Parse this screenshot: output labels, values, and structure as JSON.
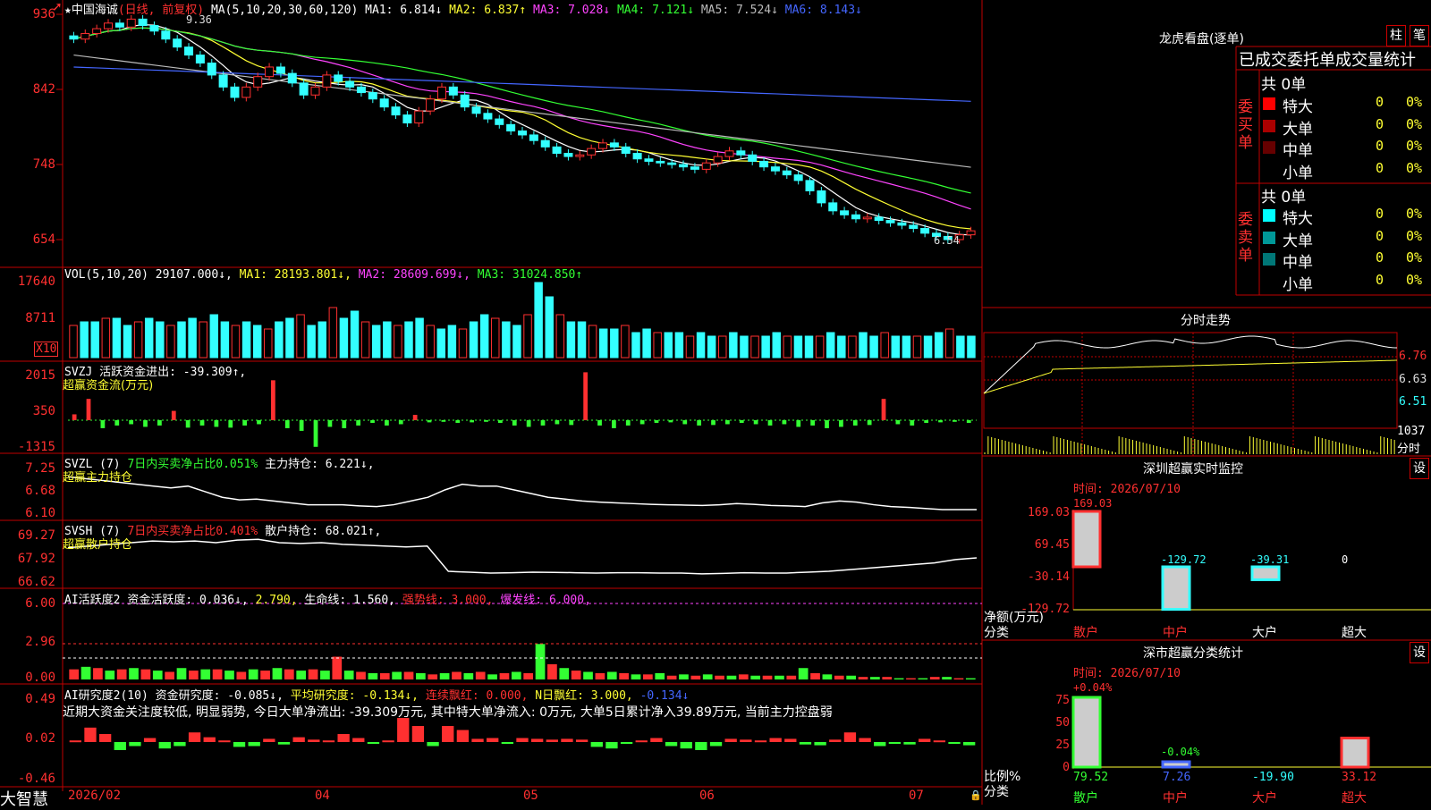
{
  "header": {
    "stock_name": "★中国海诚",
    "stock_mode": "(日线, 前复权)",
    "ma_title": "MA(5,10,20,30,60,120)",
    "ma1": "MA1: 6.814↓",
    "ma2": "MA2: 6.837↑",
    "ma3": "MA3: 7.028↓",
    "ma4": "MA4: 7.121↓",
    "ma5": "MA5: 7.524↓",
    "ma6": "MA6: 8.143↓",
    "high_label": "9.36",
    "low_label": "6.54"
  },
  "price_axis": [
    "936",
    "842",
    "748",
    "654"
  ],
  "vol_panel": {
    "title": "VOL(5,10,20)",
    "value": "29107.000↓,",
    "ma1": "MA1: 28193.801↓,",
    "ma2": "MA2: 28609.699↓,",
    "ma3": "MA3: 31024.850↑",
    "axis": [
      "17640",
      "8711",
      "X10"
    ]
  },
  "svzj_panel": {
    "title": "SVZJ  活跃资金进出: -39.309↑,",
    "subtitle": "超赢资金流(万元)",
    "axis": [
      "2015",
      "350",
      "-1315"
    ]
  },
  "svzl_panel": {
    "title": "SVZL (7)",
    "ratio": "7日内买卖净占比0.051%",
    "hold": "主力持仓: 6.221↓,",
    "subtitle": "超赢主力持仓",
    "axis": [
      "7.25",
      "6.68",
      "6.10"
    ]
  },
  "svsh_panel": {
    "title": "SVSH (7)",
    "ratio": "7日内买卖净占比0.401%",
    "hold": "散户持仓: 68.021↑,",
    "subtitle": "超赢散户持仓",
    "axis": [
      "69.27",
      "67.92",
      "66.62"
    ]
  },
  "ai_active_panel": {
    "title": "AI活跃度2",
    "activity": "资金活跃度: 0.036↓,",
    "v2": "2.790,",
    "life": "生命线: 1.560,",
    "strong": "强势线: 3.000,",
    "burst": "爆发线: 6.000,",
    "axis": [
      "6.00",
      "2.96",
      "0.00"
    ]
  },
  "ai_research_panel": {
    "title": "AI研究度2(10)",
    "research": "资金研究度: -0.085↓,",
    "avg": "平均研究度: -0.134↓,",
    "cont": "连续飘红: 0.000,",
    "n": "N日飘红: 3.000,",
    "last": "-0.134↓",
    "comment": "近期大资金关注度较低, 明显弱势, 今日大单净流出: -39.309万元, 其中特大单净流入: 0万元, 大单5日累计净入39.89万元, 当前主力控盘弱",
    "axis": [
      "0.49",
      "0.02",
      "-0.46"
    ]
  },
  "bottom_bar": {
    "brand": "大智慧",
    "dates": [
      "2026/02",
      "04",
      "05",
      "06",
      "07"
    ]
  },
  "longhu": {
    "title": "龙虎看盘(逐单)",
    "btn1": "柱",
    "btn2": "笔",
    "stats_title": "已成交委托单成交量统计",
    "buy_label": "委买单",
    "sell_label": "委卖单",
    "buy_total": "共 0单",
    "sell_total": "共 0单",
    "buy_rows": [
      {
        "name": "特大",
        "vol": "0",
        "pct": "0%",
        "color": "#ff0000"
      },
      {
        "name": "大单",
        "vol": "0",
        "pct": "0%",
        "color": "#aa0000"
      },
      {
        "name": "中单",
        "vol": "0",
        "pct": "0%",
        "color": "#660000"
      },
      {
        "name": "小单",
        "vol": "0",
        "pct": "0%",
        "color": ""
      }
    ],
    "sell_rows": [
      {
        "name": "特大",
        "vol": "0",
        "pct": "0%",
        "color": "#00ffff"
      },
      {
        "name": "大单",
        "vol": "0",
        "pct": "0%",
        "color": "#009999"
      },
      {
        "name": "中单",
        "vol": "0",
        "pct": "0%",
        "color": "#007777"
      },
      {
        "name": "小单",
        "vol": "0",
        "pct": "0%",
        "color": ""
      }
    ]
  },
  "intraday": {
    "title": "分时走势",
    "axis": [
      "6.76",
      "6.63",
      "6.51"
    ],
    "vol_label": "1037",
    "vol_sub": "分时"
  },
  "sz_monitor": {
    "title": "深圳超赢实时监控",
    "btn": "设",
    "time": "时间: 2026/07/10",
    "axis": [
      "169.03",
      "69.45",
      "-30.14",
      "-129.72"
    ],
    "unit": "净额(万元)",
    "cat_label": "分类",
    "categories": [
      "散户",
      "中户",
      "大户",
      "超大"
    ],
    "values": [
      169.03,
      -129.72,
      -39.31,
      0
    ],
    "value_labels": [
      "169.03",
      "-129.72",
      "-39.31",
      "0"
    ]
  },
  "sz_class": {
    "title": "深市超赢分类统计",
    "btn": "设",
    "time": "时间: 2026/07/10",
    "axis": [
      "75",
      "50",
      "25",
      "0"
    ],
    "unit": "比例%",
    "cat_label": "分类",
    "categories": [
      "散户",
      "中户",
      "大户",
      "超大"
    ],
    "values": [
      79.52,
      7.26,
      -19.9,
      33.12
    ],
    "value_labels": [
      "79.52",
      "7.26",
      "-19.90",
      "33.12"
    ],
    "top_labels": [
      "+0.04%",
      "-0.04%"
    ]
  },
  "chart_data": [
    {
      "type": "candlestick",
      "title": "中国海诚 (日线, 前复权)",
      "ylim": [
        654,
        936
      ],
      "x": [
        "2026/02",
        "04",
        "05",
        "06",
        "07"
      ],
      "close_series": [
        905,
        912,
        918,
        925,
        920,
        930,
        922,
        915,
        905,
        895,
        885,
        875,
        860,
        845,
        832,
        845,
        858,
        870,
        862,
        850,
        835,
        845,
        860,
        852,
        845,
        838,
        830,
        820,
        810,
        800,
        815,
        830,
        845,
        835,
        820,
        812,
        805,
        798,
        790,
        785,
        778,
        770,
        762,
        758,
        760,
        768,
        775,
        770,
        762,
        755,
        752,
        750,
        748,
        745,
        742,
        750,
        758,
        765,
        760,
        752,
        745,
        740,
        735,
        728,
        715,
        700,
        690,
        685,
        680,
        682,
        678,
        675,
        672,
        668,
        662,
        658,
        654,
        660,
        665
      ],
      "high": 9.36,
      "low": 6.54
    },
    {
      "type": "bar",
      "title": "VOL(5,10,20)",
      "ylim": [
        0,
        17640
      ],
      "values": [
        9,
        10,
        10,
        11,
        11,
        9,
        10,
        11,
        10,
        9,
        10,
        11,
        10,
        12,
        10,
        9,
        10,
        9,
        8,
        10,
        11,
        12,
        9,
        10,
        14,
        11,
        13,
        10,
        9,
        10,
        9,
        10,
        11,
        9,
        8,
        9,
        8,
        10,
        12,
        11,
        10,
        9,
        12,
        21,
        17,
        12,
        10,
        10,
        9,
        8,
        8,
        9,
        7,
        8,
        7,
        7,
        7,
        6,
        7,
        6,
        6,
        7,
        6,
        6,
        6,
        7,
        6,
        6,
        6,
        6,
        7,
        6,
        6,
        7,
        6,
        7,
        6,
        6,
        6,
        6,
        7,
        8,
        6,
        6
      ]
    },
    {
      "type": "bar",
      "title": "超赢资金流(万元)",
      "ylim": [
        -1315,
        2015
      ],
      "values": [
        220,
        800,
        -300,
        -200,
        -150,
        -250,
        -200,
        350,
        -280,
        -200,
        -250,
        -280,
        -200,
        -150,
        1500,
        -300,
        -400,
        -1000,
        -250,
        -300,
        -200,
        -100,
        -200,
        -150,
        200,
        -80,
        -60,
        -100,
        -80,
        -60,
        -100,
        -200,
        -250,
        -200,
        -150,
        -180,
        1800,
        -200,
        -300,
        -200,
        -150,
        -100,
        -80,
        -150,
        -200,
        -180,
        -150,
        -100,
        -150,
        -200,
        -150,
        -250,
        -200,
        -300,
        -250,
        -200,
        -180,
        800,
        -150,
        -200,
        -100,
        -80,
        -60,
        -100
      ]
    },
    {
      "type": "line",
      "title": "超赢主力持仓",
      "ylim": [
        6.1,
        7.25
      ],
      "values": [
        7.1,
        7.05,
        7.0,
        6.95,
        6.9,
        6.85,
        6.8,
        6.85,
        6.7,
        6.55,
        6.48,
        6.5,
        6.45,
        6.4,
        6.35,
        6.35,
        6.35,
        6.32,
        6.3,
        6.35,
        6.45,
        6.55,
        6.75,
        6.9,
        6.85,
        6.85,
        6.75,
        6.65,
        6.55,
        6.5,
        6.45,
        6.42,
        6.4,
        6.38,
        6.36,
        6.35,
        6.34,
        6.33,
        6.35,
        6.38,
        6.36,
        6.33,
        6.32,
        6.3,
        6.4,
        6.45,
        6.42,
        6.35,
        6.3,
        6.28,
        6.25,
        6.22,
        6.22,
        6.22
      ]
    },
    {
      "type": "line",
      "title": "超赢散户持仓",
      "ylim": [
        66.62,
        69.27
      ],
      "values": [
        68.6,
        68.7,
        68.8,
        68.9,
        69.0,
        68.95,
        69.0,
        68.9,
        69.05,
        69.1,
        68.9,
        68.85,
        68.9,
        68.8,
        68.75,
        68.7,
        68.65,
        68.7,
        67.2,
        67.15,
        67.1,
        67.12,
        67.15,
        67.14,
        67.12,
        67.1,
        67.12,
        67.12,
        67.1,
        67.1,
        67.05,
        67.08,
        67.12,
        67.1,
        67.1,
        67.15,
        67.2,
        67.3,
        67.4,
        67.5,
        67.6,
        67.7,
        67.9,
        68.0
      ]
    },
    {
      "type": "bar",
      "title": "AI活跃度2",
      "ylim": [
        0,
        6.0
      ],
      "values": [
        0.8,
        1.0,
        0.9,
        0.7,
        0.8,
        0.9,
        0.8,
        0.7,
        0.6,
        0.9,
        0.7,
        0.8,
        0.8,
        0.7,
        0.6,
        0.8,
        0.7,
        0.9,
        0.8,
        0.7,
        0.8,
        0.7,
        1.8,
        0.7,
        0.6,
        0.5,
        0.5,
        0.6,
        0.6,
        0.5,
        0.4,
        0.5,
        0.6,
        0.5,
        0.6,
        0.4,
        0.5,
        0.6,
        0.5,
        2.8,
        1.2,
        0.9,
        0.7,
        0.6,
        0.5,
        0.6,
        0.5,
        0.4,
        0.4,
        0.5,
        0.3,
        0.4,
        0.3,
        0.4,
        0.3,
        0.3,
        0.4,
        0.3,
        0.3,
        0.3,
        0.3,
        0.9,
        0.5,
        0.4,
        0.3,
        0.3,
        0.2,
        0.2,
        0.2,
        0.1,
        0.1,
        0.1,
        0.2,
        0.2,
        0.1,
        0.1
      ]
    },
    {
      "type": "bar",
      "title": "AI研究度2(10)",
      "ylim": [
        -0.46,
        0.49
      ],
      "values": [
        0.02,
        0.18,
        0.1,
        -0.1,
        -0.05,
        0.05,
        -0.08,
        -0.05,
        0.12,
        0.06,
        0.02,
        -0.06,
        -0.05,
        0.04,
        -0.03,
        0.06,
        0.03,
        0.02,
        0.1,
        0.05,
        -0.02,
        0.02,
        0.3,
        0.2,
        -0.05,
        0.2,
        0.15,
        0.04,
        0.05,
        -0.02,
        0.05,
        0.04,
        0.03,
        0.04,
        0.03,
        -0.06,
        -0.08,
        -0.02,
        0.02,
        0.05,
        -0.05,
        -0.08,
        -0.1,
        -0.05,
        0.04,
        0.03,
        0.02,
        0.05,
        0.04,
        -0.03,
        -0.04,
        0.03,
        0.12,
        0.05,
        -0.05,
        -0.02,
        -0.03,
        0.04,
        0.02,
        -0.02,
        -0.04
      ]
    },
    {
      "type": "bar",
      "title": "深圳超赢实时监控",
      "categories": [
        "散户",
        "中户",
        "大户",
        "超大"
      ],
      "values": [
        169.03,
        -129.72,
        -39.31,
        0
      ],
      "ylabel": "净额(万元)",
      "ylim": [
        -129.72,
        169.03
      ]
    },
    {
      "type": "bar",
      "title": "深市超赢分类统计",
      "categories": [
        "散户",
        "中户",
        "大户",
        "超大"
      ],
      "values": [
        79.52,
        7.26,
        -19.9,
        33.12
      ],
      "ylabel": "比例%",
      "ylim": [
        0,
        75
      ]
    }
  ]
}
